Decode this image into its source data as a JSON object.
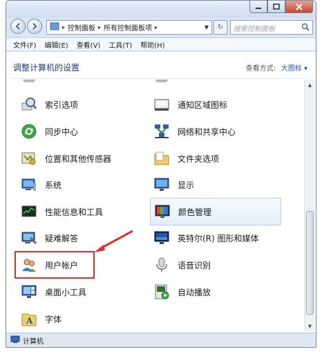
{
  "window": {
    "address": {
      "segments": [
        "控制面板",
        "所有控制面板项"
      ],
      "search_placeholder": "搜索控制面板"
    },
    "menu": [
      "文件(F)",
      "编辑(E)",
      "查看(V)",
      "工具(T)",
      "帮助(H)"
    ]
  },
  "content": {
    "heading": "调整计算机的设置",
    "view_by_label": "查看方式:",
    "view_by_value": "大图标 ▾",
    "items": [
      {
        "label": "索引选项",
        "icon": "magnifier-icon"
      },
      {
        "label": "通知区域图标",
        "icon": "notification-area-icon"
      },
      {
        "label": "同步中心",
        "icon": "sync-center-icon"
      },
      {
        "label": "网络和共享中心",
        "icon": "network-icon"
      },
      {
        "label": "位置和其他传感器",
        "icon": "sensor-icon"
      },
      {
        "label": "文件夹选项",
        "icon": "folder-icon"
      },
      {
        "label": "系统",
        "icon": "system-icon"
      },
      {
        "label": "显示",
        "icon": "display-icon"
      },
      {
        "label": "性能信息和工具",
        "icon": "performance-icon"
      },
      {
        "label": "颜色管理",
        "icon": "color-management-icon"
      },
      {
        "label": "疑难解答",
        "icon": "troubleshoot-icon"
      },
      {
        "label": "英特尔(R) 图形和媒体",
        "icon": "intel-graphics-icon"
      },
      {
        "label": "用户帐户",
        "icon": "user-accounts-icon"
      },
      {
        "label": "语音识别",
        "icon": "microphone-icon"
      },
      {
        "label": "桌面小工具",
        "icon": "gadgets-icon"
      },
      {
        "label": "自动播放",
        "icon": "autoplay-icon"
      },
      {
        "label": "字体",
        "icon": "fonts-icon"
      }
    ]
  },
  "status": {
    "text": "计算机"
  },
  "colors": {
    "highlight": "#d9302b",
    "heading": "#1f3b72",
    "accent": "#2155b4"
  }
}
